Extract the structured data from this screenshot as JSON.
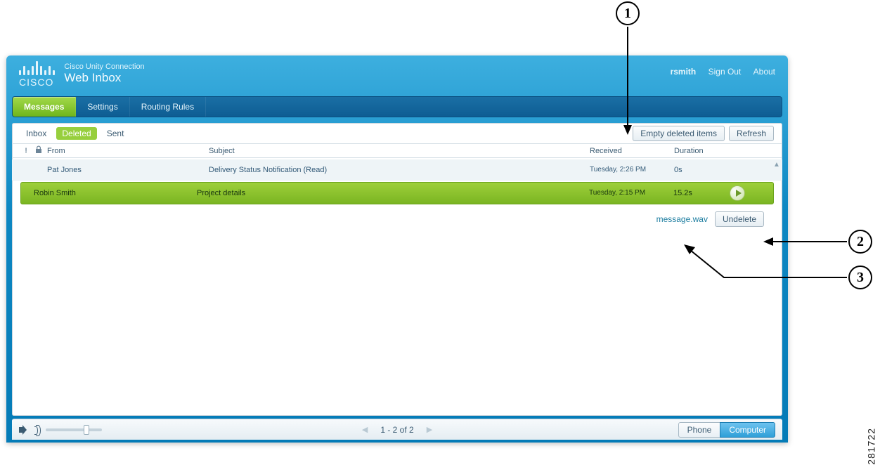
{
  "brand": {
    "small": "Cisco Unity Connection",
    "large": "Web Inbox",
    "cisco_word": "CISCO"
  },
  "header": {
    "username": "rsmith",
    "sign_out": "Sign Out",
    "about": "About"
  },
  "nav": {
    "tabs": [
      {
        "label": "Messages",
        "active": true
      },
      {
        "label": "Settings",
        "active": false
      },
      {
        "label": "Routing Rules",
        "active": false
      }
    ]
  },
  "folders": {
    "items": [
      {
        "label": "Inbox",
        "active": false
      },
      {
        "label": "Deleted",
        "active": true
      },
      {
        "label": "Sent",
        "active": false
      }
    ],
    "empty_btn": "Empty deleted items",
    "refresh_btn": "Refresh"
  },
  "columns": {
    "from": "From",
    "subject": "Subject",
    "received": "Received",
    "duration": "Duration"
  },
  "messages": [
    {
      "from": "Pat Jones",
      "subject": "Delivery Status Notification (Read)",
      "received": "Tuesday, 2:26 PM",
      "duration": "0s",
      "selected": false
    },
    {
      "from": "Robin Smith",
      "subject": "Project details",
      "received": "Tuesday, 2:15 PM",
      "duration": "15.2s",
      "selected": true
    }
  ],
  "detail": {
    "attachment": "message.wav",
    "undelete_btn": "Undelete"
  },
  "footer": {
    "pager_text": "1 - 2 of 2",
    "phone": "Phone",
    "computer": "Computer"
  },
  "annotations": {
    "c1": "1",
    "c2": "2",
    "c3": "3",
    "figure_id": "281722"
  },
  "icons": {
    "priority_flag": "!",
    "lock": "lock-icon",
    "play": "play-icon",
    "speaker": "speaker-icon",
    "chevl": "◀",
    "chevr": "▶",
    "scroll_up": "▲"
  }
}
